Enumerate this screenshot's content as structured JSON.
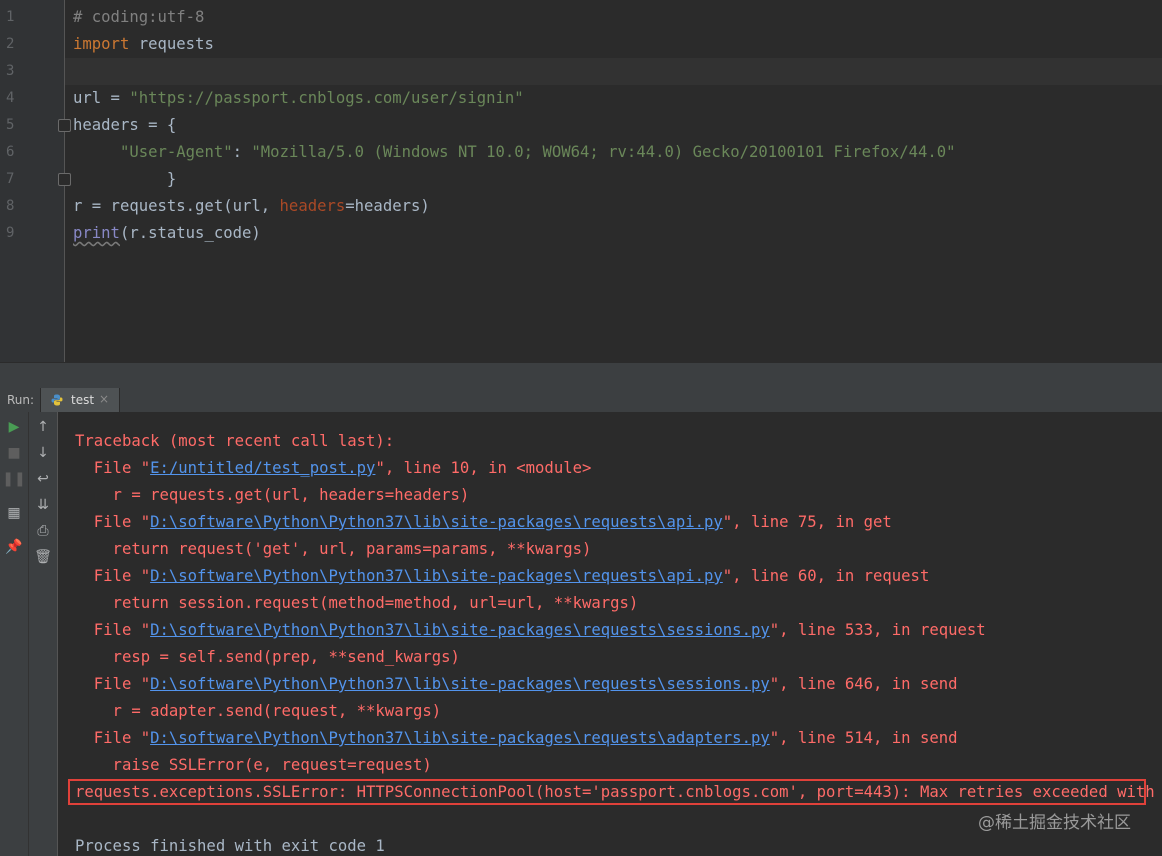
{
  "editor": {
    "line_numbers": [
      "1",
      "2",
      "3",
      "4",
      "5",
      "6",
      "7",
      "8",
      "9"
    ],
    "lines": [
      {
        "segments": [
          {
            "t": "# coding:utf-8",
            "c": "cmt"
          }
        ]
      },
      {
        "segments": [
          {
            "t": "import",
            "c": "kw"
          },
          {
            "t": " requests",
            "c": ""
          }
        ]
      },
      {
        "segments": []
      },
      {
        "segments": [
          {
            "t": "url = ",
            "c": ""
          },
          {
            "t": "\"https://passport.cnblogs.com/user/signin\"",
            "c": "str"
          }
        ]
      },
      {
        "segments": [
          {
            "t": "headers = {",
            "c": ""
          }
        ]
      },
      {
        "segments": [
          {
            "t": "     ",
            "c": ""
          },
          {
            "t": "\"User-Agent\"",
            "c": "str"
          },
          {
            "t": ": ",
            "c": ""
          },
          {
            "t": "\"Mozilla/5.0 (Windows NT 10.0; WOW64; rv:44.0) Gecko/20100101 Firefox/44.0\"",
            "c": "str"
          }
        ]
      },
      {
        "segments": [
          {
            "t": "          }",
            "c": ""
          }
        ]
      },
      {
        "segments": [
          {
            "t": "r = requests.get(url, ",
            "c": ""
          },
          {
            "t": "headers",
            "c": "param"
          },
          {
            "t": "=headers)",
            "c": ""
          }
        ]
      },
      {
        "segments": [
          {
            "t": "print",
            "c": "builtin"
          },
          {
            "t": "(r.status_code)",
            "c": ""
          }
        ]
      }
    ]
  },
  "run_panel": {
    "label": "Run:",
    "tab_label": "test",
    "tab_close": "×",
    "toolbar_left": [
      {
        "icon": "rerun-icon",
        "glyph": "▶",
        "color": "#499c54"
      },
      {
        "icon": "stop-icon",
        "glyph": "■",
        "color": "#5e5e5e"
      },
      {
        "icon": "pause-icon",
        "glyph": "❚❚",
        "color": "#5e5e5e"
      },
      {
        "icon": "layout-icon",
        "glyph": "▦",
        "color": "#aeb0b2"
      },
      {
        "icon": "pin-icon",
        "glyph": "📌",
        "color": "#aeb0b2"
      }
    ],
    "toolbar_right": [
      {
        "icon": "up-arrow-icon",
        "glyph": "↑"
      },
      {
        "icon": "down-arrow-icon",
        "glyph": "↓"
      },
      {
        "icon": "soft-wrap-icon",
        "glyph": "↩"
      },
      {
        "icon": "scroll-to-end-icon",
        "glyph": "⇊"
      },
      {
        "icon": "print-icon",
        "glyph": "⎙"
      },
      {
        "icon": "trash-icon",
        "glyph": "🗑"
      }
    ]
  },
  "console": {
    "lines": [
      {
        "segments": [
          {
            "t": "Traceback (most recent call last):",
            "c": ""
          }
        ]
      },
      {
        "segments": [
          {
            "t": "  File \"",
            "c": ""
          },
          {
            "t": "E:/untitled/test_post.py",
            "c": "link"
          },
          {
            "t": "\", line 10, in <module>",
            "c": ""
          }
        ]
      },
      {
        "segments": [
          {
            "t": "    r = requests.get(url, headers=headers)",
            "c": ""
          }
        ]
      },
      {
        "segments": [
          {
            "t": "  File \"",
            "c": ""
          },
          {
            "t": "D:\\software\\Python\\Python37\\lib\\site-packages\\requests\\api.py",
            "c": "link"
          },
          {
            "t": "\", line 75, in get",
            "c": ""
          }
        ]
      },
      {
        "segments": [
          {
            "t": "    return request('get', url, params=params, **kwargs)",
            "c": ""
          }
        ]
      },
      {
        "segments": [
          {
            "t": "  File \"",
            "c": ""
          },
          {
            "t": "D:\\software\\Python\\Python37\\lib\\site-packages\\requests\\api.py",
            "c": "link"
          },
          {
            "t": "\", line 60, in request",
            "c": ""
          }
        ]
      },
      {
        "segments": [
          {
            "t": "    return session.request(method=method, url=url, **kwargs)",
            "c": ""
          }
        ]
      },
      {
        "segments": [
          {
            "t": "  File \"",
            "c": ""
          },
          {
            "t": "D:\\software\\Python\\Python37\\lib\\site-packages\\requests\\sessions.py",
            "c": "link"
          },
          {
            "t": "\", line 533, in request",
            "c": ""
          }
        ]
      },
      {
        "segments": [
          {
            "t": "    resp = self.send(prep, **send_kwargs)",
            "c": ""
          }
        ]
      },
      {
        "segments": [
          {
            "t": "  File \"",
            "c": ""
          },
          {
            "t": "D:\\software\\Python\\Python37\\lib\\site-packages\\requests\\sessions.py",
            "c": "link"
          },
          {
            "t": "\", line 646, in send",
            "c": ""
          }
        ]
      },
      {
        "segments": [
          {
            "t": "    r = adapter.send(request, **kwargs)",
            "c": ""
          }
        ]
      },
      {
        "segments": [
          {
            "t": "  File \"",
            "c": ""
          },
          {
            "t": "D:\\software\\Python\\Python37\\lib\\site-packages\\requests\\adapters.py",
            "c": "link"
          },
          {
            "t": "\", line 514, in send",
            "c": ""
          }
        ]
      },
      {
        "segments": [
          {
            "t": "    raise SSLError(e, request=request)",
            "c": ""
          }
        ]
      },
      {
        "segments": [
          {
            "t": "requests.exceptions.SSLError: HTTPSConnectionPool(host='passport.cnblogs.com', port=443): Max retries exceeded with url:",
            "c": ""
          }
        ]
      },
      {
        "segments": []
      },
      {
        "segments": [
          {
            "t": "Process finished with exit code 1",
            "c": "normal"
          }
        ]
      }
    ]
  },
  "watermark": "@稀土掘金技术社区",
  "colors": {
    "editor_bg": "#2b2b2b",
    "gutter_bg": "#313335",
    "error_text": "#ff6b68",
    "link": "#5394ec",
    "highlight_box": "#e0413a"
  }
}
